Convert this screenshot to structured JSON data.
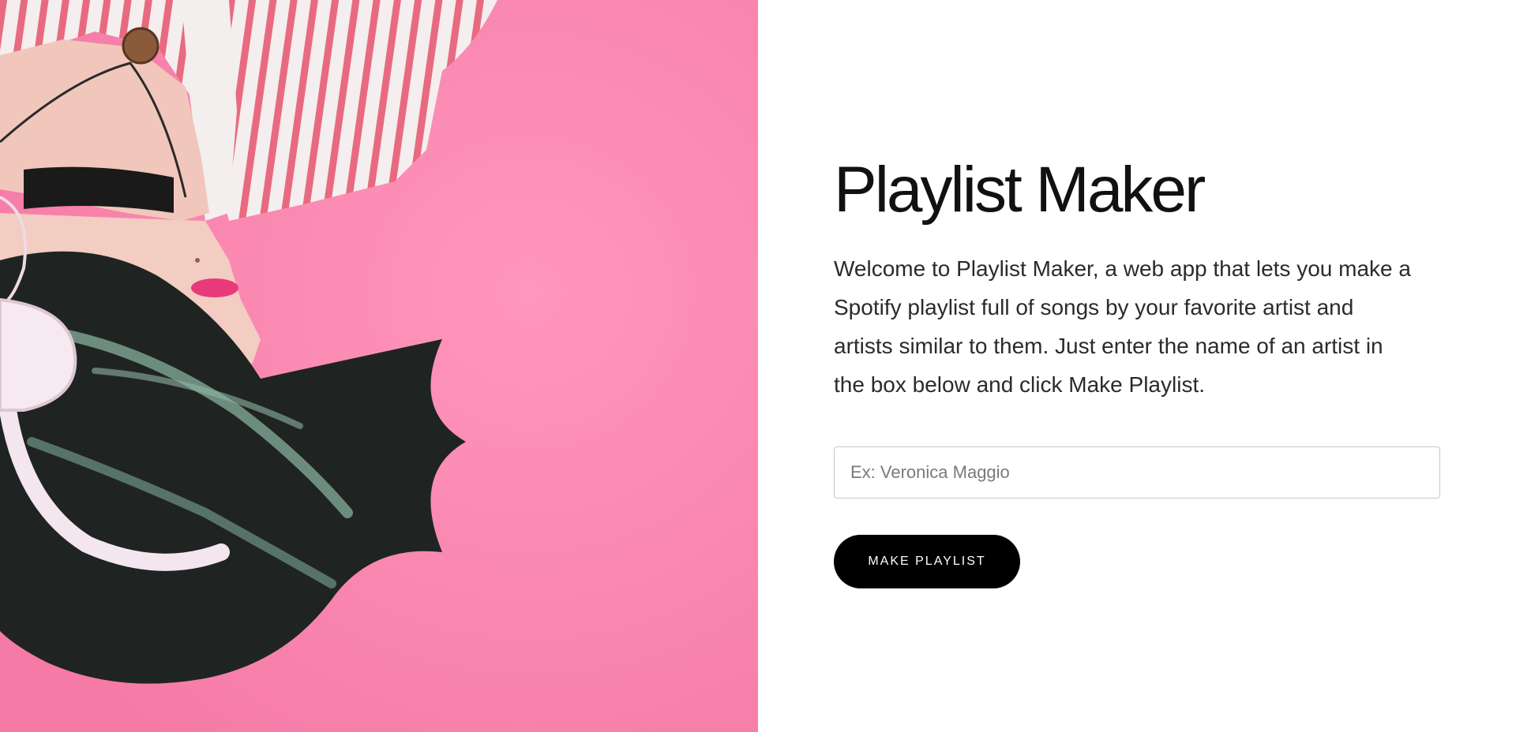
{
  "hero": {
    "image_name": "woman-with-headphones-on-pink-background",
    "background_color": "#ff8cb4"
  },
  "main": {
    "title": "Playlist Maker",
    "intro": "Welcome to Playlist Maker, a web app that lets you make a Spotify playlist full of songs by your favorite artist and artists similar to them. Just enter the name of an artist in the box below and click Make Playlist.",
    "artist_input": {
      "placeholder": "Ex: Veronica Maggio",
      "value": ""
    },
    "button_label": "MAKE PLAYLIST"
  },
  "colors": {
    "accent": "#000000",
    "text": "#111111"
  }
}
